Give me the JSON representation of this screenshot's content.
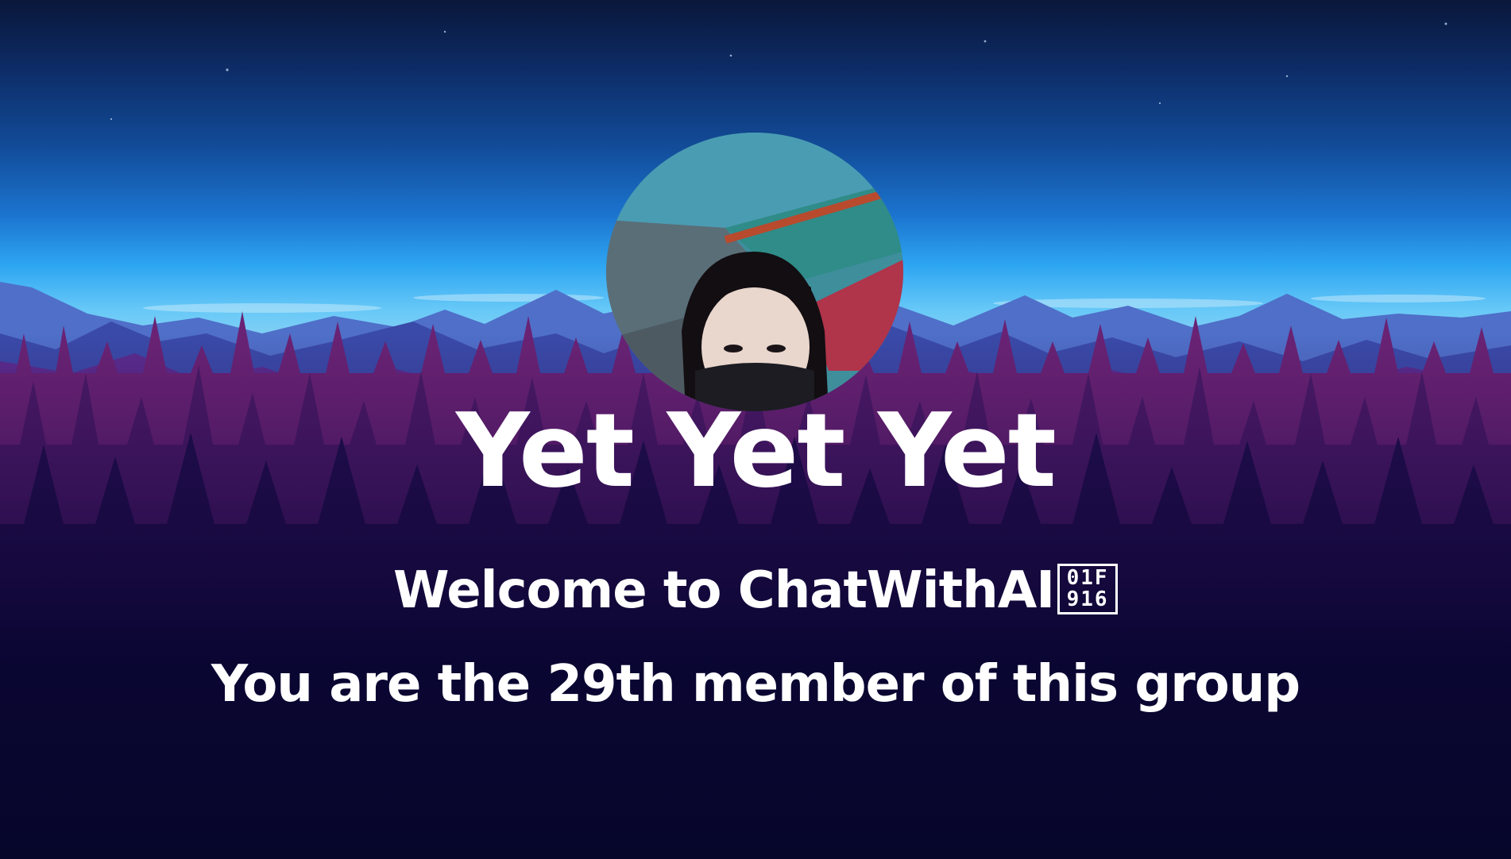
{
  "card": {
    "title": "Yet Yet Yet",
    "welcome_text": "Welcome to ChatWithAI",
    "emoji_glyph": {
      "top": "01F",
      "bottom": "916"
    },
    "member_text": "You are the 29th member of this group"
  },
  "colors": {
    "sky_top": "#0a1840",
    "sky_horizon": "#2ea4f0",
    "mountains": "#3b53b8",
    "forest_purple": "#5b1f7a",
    "ground": "#07062a",
    "text": "#ffffff"
  }
}
